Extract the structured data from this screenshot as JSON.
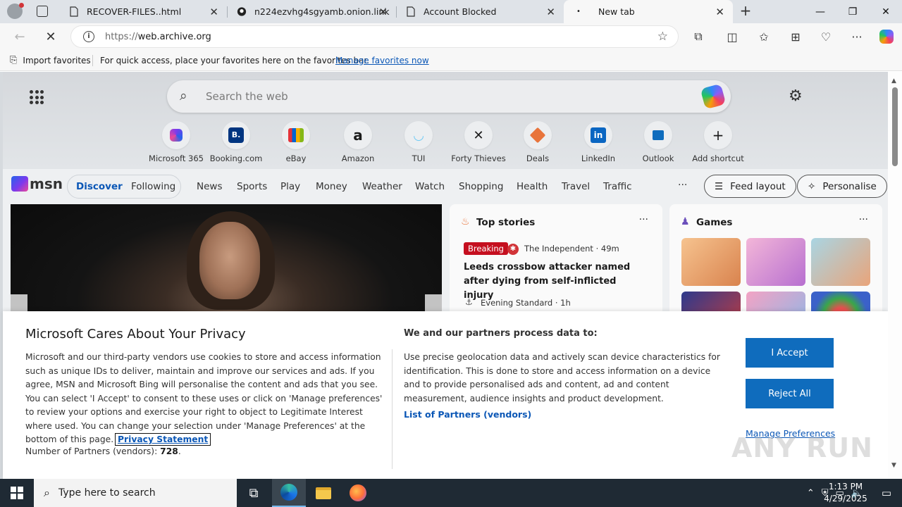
{
  "browser": {
    "tabs": [
      {
        "label": "RECOVER-FILES..html",
        "icon": "document-icon"
      },
      {
        "label": "n224ezvhg4sgyamb.onion.link",
        "icon": "github-icon"
      },
      {
        "label": "Account Blocked",
        "icon": "document-icon"
      },
      {
        "label": "New tab",
        "icon": "dot-icon"
      }
    ],
    "url_scheme": "https://",
    "url_host": "web.archive.org",
    "favorites_bar": {
      "import_label": "Import favorites",
      "hint": "For quick access, place your favorites here on the favorites bar.",
      "manage_link": "Manage favorites now"
    }
  },
  "newtab": {
    "search_placeholder": "Search the web",
    "shortcuts": [
      {
        "label": "Microsoft 365",
        "glyph": ""
      },
      {
        "label": "Booking.com",
        "glyph": "B."
      },
      {
        "label": "eBay",
        "glyph": ""
      },
      {
        "label": "Amazon",
        "glyph": "a"
      },
      {
        "label": "TUI",
        "glyph": ""
      },
      {
        "label": "Forty Thieves",
        "glyph": ""
      },
      {
        "label": "Deals",
        "glyph": ""
      },
      {
        "label": "LinkedIn",
        "glyph": "in"
      },
      {
        "label": "Outlook",
        "glyph": ""
      },
      {
        "label": "Add shortcut",
        "glyph": "+"
      }
    ],
    "msn": {
      "logo_text": "msn",
      "segment": {
        "discover": "Discover",
        "following": "Following"
      },
      "nav": [
        "News",
        "Sports",
        "Play",
        "Money",
        "Weather",
        "Watch",
        "Shopping",
        "Health",
        "Travel",
        "Traffic"
      ],
      "more": "···",
      "feed_layout": "Feed layout",
      "personalise": "Personalise"
    },
    "top_stories": {
      "title": "Top stories",
      "badge": "Breaking",
      "source1": "The Independent · 49m",
      "headline1": "Leeds crossbow attacker named after dying from self-inflicted injury",
      "source2": "Evening Standard · 1h"
    },
    "games": {
      "title": "Games"
    }
  },
  "consent": {
    "title": "Microsoft Cares About Your Privacy",
    "body": "Microsoft and our third-party vendors use cookies to store and access information such as unique IDs to deliver, maintain and improve our services and ads. If you agree, MSN and Microsoft Bing will personalise the content and ads that you see. You can select 'I Accept' to consent to these uses or click on 'Manage preferences' to review your options and exercise your right to object to Legitimate Interest where used. You can change your selection under 'Manage Preferences' at the bottom of this page.",
    "privacy_link": "Privacy Statement",
    "partners_label": "Number of Partners (vendors):",
    "partners_count": "728",
    "purpose_title": "We and our partners process data to:",
    "purpose_body": "Use precise geolocation data and actively scan device characteristics for identification. This is done to store and access information on a device and to provide personalised ads and content, ad and content measurement, audience insights and product development.",
    "vendors_link": "List of Partners (vendors)",
    "accept": "I Accept",
    "reject": "Reject All",
    "manage": "Manage Preferences"
  },
  "watermark": "ANY RUN",
  "taskbar": {
    "search_placeholder": "Type here to search",
    "time": "1:13 PM",
    "date": "4/29/2025"
  },
  "colors": {
    "accent": "#0f6cbd",
    "link": "#0b57b6",
    "breaking": "#c50f1f",
    "taskbar": "#1f2a34"
  }
}
